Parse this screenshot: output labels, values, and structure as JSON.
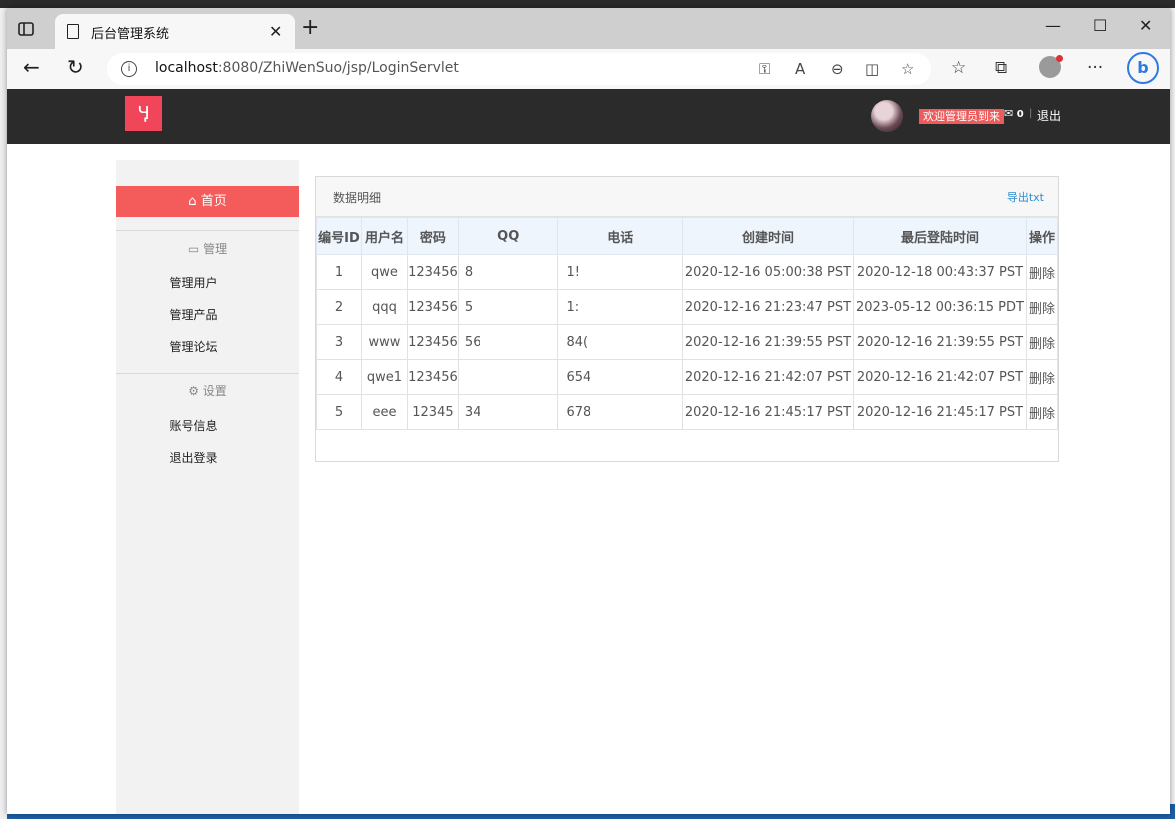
{
  "browser": {
    "tab_title": "后台管理系统",
    "url_host": "localhost",
    "url_rest": ":8080/ZhiWenSuo/jsp/LoginServlet"
  },
  "header": {
    "welcome": "欢迎管理员到来",
    "mail_count": "0",
    "logout": "退出"
  },
  "sidebar": {
    "home": "首页",
    "group_manage": "管理",
    "manage_items": [
      "管理用户",
      "管理产品",
      "管理论坛"
    ],
    "group_settings": "设置",
    "settings_items": [
      "账号信息",
      "退出登录"
    ]
  },
  "panel": {
    "title": "数据明细",
    "export": "导出txt",
    "columns": [
      "编号ID",
      "用户名",
      "密码",
      "QQ",
      "电话",
      "创建时间",
      "最后登陆时间",
      "操作"
    ],
    "rows": [
      {
        "id": "1",
        "username": "qwe",
        "password": "123456",
        "qq": "8",
        "phone": "1!",
        "created": "2020-12-16 05:00:38 PST",
        "last_login": "2020-12-18 00:43:37 PST",
        "action": "删除"
      },
      {
        "id": "2",
        "username": "qqq",
        "password": "123456",
        "qq": "5",
        "phone": "1:",
        "created": "2020-12-16 21:23:47 PST",
        "last_login": "2023-05-12 00:36:15 PDT",
        "action": "删除"
      },
      {
        "id": "3",
        "username": "www",
        "password": "123456",
        "qq": "56",
        "phone": "84(",
        "created": "2020-12-16 21:39:55 PST",
        "last_login": "2020-12-16 21:39:55 PST",
        "action": "删除"
      },
      {
        "id": "4",
        "username": "qwe1",
        "password": "123456",
        "qq": "",
        "phone": "654",
        "created": "2020-12-16 21:42:07 PST",
        "last_login": "2020-12-16 21:42:07 PST",
        "action": "删除"
      },
      {
        "id": "5",
        "username": "eee",
        "password": "12345",
        "qq": "34",
        "phone": "678!",
        "created": "2020-12-16 21:45:17 PST",
        "last_login": "2020-12-16 21:45:17 PST",
        "action": "删除"
      }
    ]
  }
}
